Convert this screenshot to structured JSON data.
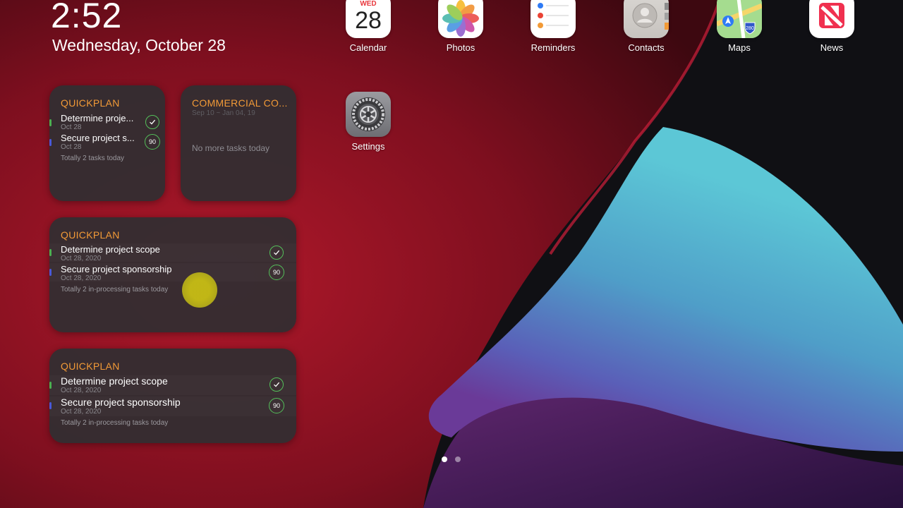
{
  "clock": {
    "time": "2:52",
    "date": "Wednesday, October 28"
  },
  "colors": {
    "accent_orange": "#f29a37",
    "check_green": "#54c05a",
    "widget_bg": "#302e32"
  },
  "widgets": {
    "small_quickplan": {
      "title": "QUICKPLAN",
      "tasks": [
        {
          "name": "Determine proje...",
          "date": "Oct 28",
          "status": "done",
          "bar_color": "#4caf50"
        },
        {
          "name": "Secure project s...",
          "date": "Oct 28",
          "progress": "90",
          "bar_color": "#4a58d8"
        }
      ],
      "footer": "Totally 2 tasks today"
    },
    "small_commercial": {
      "title": "COMMERCIAL CO...",
      "range": "Sep 10 ~ Jan 04, 19",
      "empty_text": "No more tasks today"
    },
    "medium_quickplan_1": {
      "title": "QUICKPLAN",
      "tasks": [
        {
          "name": "Determine project scope",
          "date": "Oct 28, 2020",
          "status": "done",
          "bar_color": "#4caf50"
        },
        {
          "name": "Secure project sponsorship",
          "date": "Oct 28, 2020",
          "progress": "90",
          "bar_color": "#4a58d8"
        }
      ],
      "footer": "Totally 2 in-processing tasks today"
    },
    "medium_quickplan_2": {
      "title": "QUICKPLAN",
      "tasks": [
        {
          "name": "Determine project scope",
          "date": "Oct 28, 2020",
          "status": "done",
          "bar_color": "#4caf50"
        },
        {
          "name": "Secure project sponsorship",
          "date": "Oct 28, 2020",
          "progress": "90",
          "bar_color": "#4a58d8"
        }
      ],
      "footer": "Totally 2 in-processing tasks today"
    }
  },
  "apps": [
    {
      "label": "Calendar",
      "icon": "calendar-icon",
      "day_abbr": "WED",
      "day_num": "28"
    },
    {
      "label": "Photos",
      "icon": "photos-icon"
    },
    {
      "label": "Reminders",
      "icon": "reminders-icon"
    },
    {
      "label": "Contacts",
      "icon": "contacts-icon"
    },
    {
      "label": "Maps",
      "icon": "maps-icon",
      "shield": "280"
    },
    {
      "label": "News",
      "icon": "news-icon"
    },
    {
      "label": "Settings",
      "icon": "settings-icon"
    }
  ],
  "page_indicator": {
    "pages": 2,
    "current": 1
  }
}
